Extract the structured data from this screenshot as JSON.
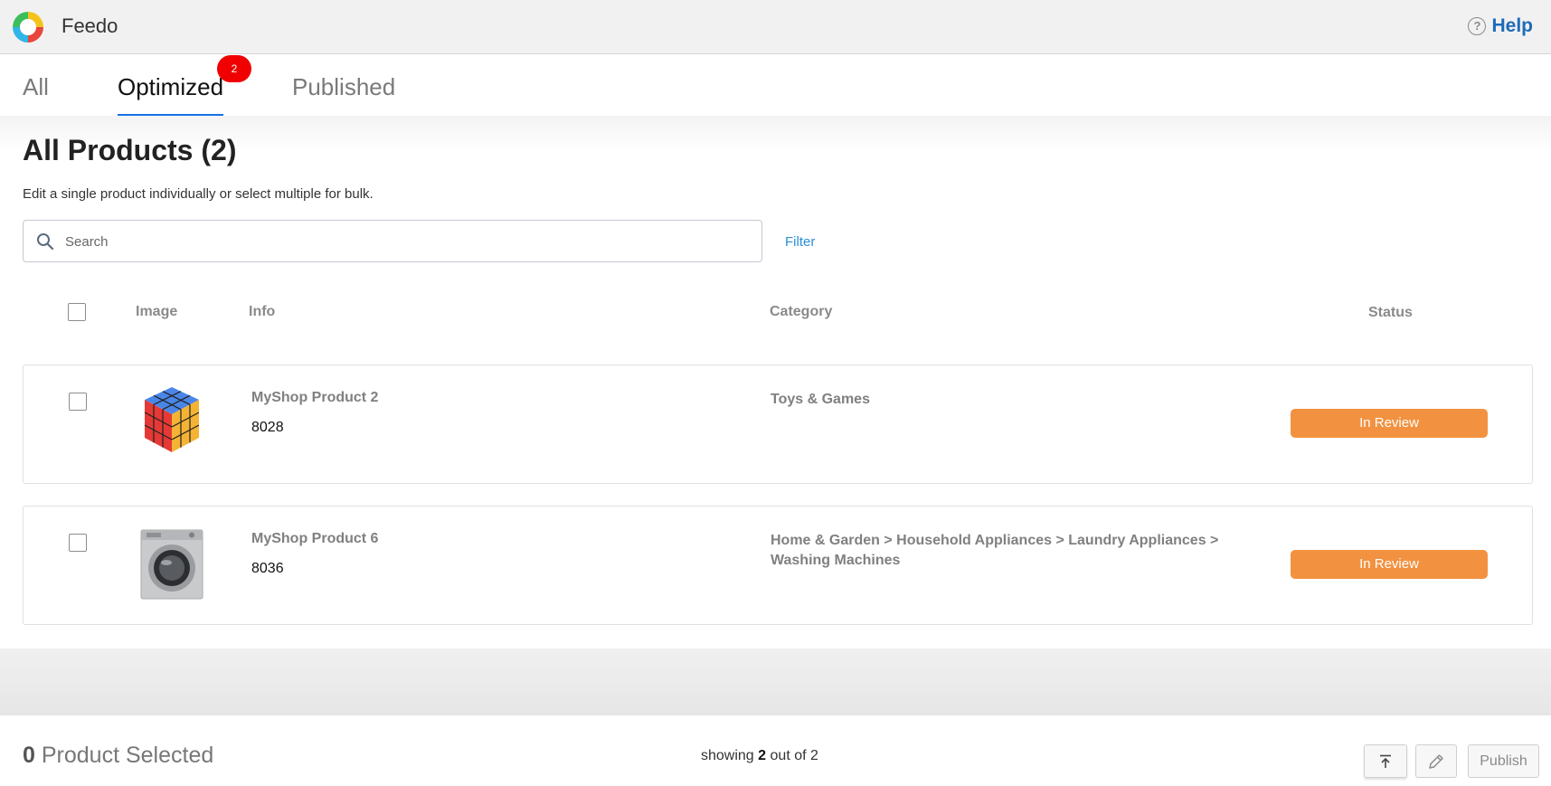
{
  "app": {
    "name": "Feedo",
    "help_label": "Help"
  },
  "tabs": [
    {
      "label": "All",
      "active": false
    },
    {
      "label": "Optimized",
      "active": true,
      "badge": "2"
    },
    {
      "label": "Published",
      "active": false
    }
  ],
  "page": {
    "title": "All Products (2)",
    "subtitle": "Edit a single product individually or select multiple for bulk."
  },
  "search": {
    "placeholder": "Search",
    "value": ""
  },
  "filter_label": "Filter",
  "table": {
    "headers": {
      "image": "Image",
      "info": "Info",
      "category": "Category",
      "status": "Status"
    },
    "rows": [
      {
        "name": "MyShop Product 2",
        "id": "8028",
        "category": "Toys & Games",
        "status": "In Review",
        "image_icon": "rubiks-cube-image"
      },
      {
        "name": "MyShop Product 6",
        "id": "8036",
        "category": "Home & Garden > Household Appliances > Laundry Appliances > Washing Machines",
        "status": "In Review",
        "image_icon": "washing-machine-image"
      }
    ]
  },
  "footer": {
    "selected_count": "0",
    "selected_label": "Product Selected",
    "showing_prefix": "showing",
    "showing_count": "2",
    "showing_suffix": "out of 2",
    "publish_label": "Publish"
  },
  "colors": {
    "status_in_review": "#f29240",
    "accent": "#1473e6",
    "badge": "#f00000",
    "link": "#2a8fd8"
  }
}
